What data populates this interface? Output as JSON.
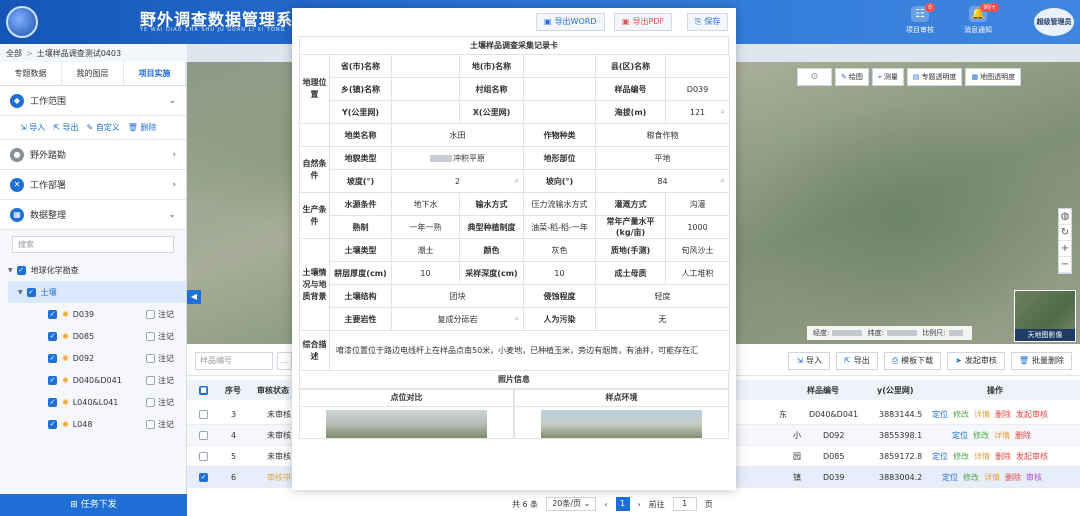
{
  "header": {
    "title": "野外调查数据管理系统",
    "pinyin": "YE WAI DIAO CHA SHU JU GUAN LI XI TONG",
    "review_label": "项目审核",
    "review_badge": "0",
    "notice_label": "消息通知",
    "notice_badge": "99+",
    "user": "超级管理员"
  },
  "breadcrumb": {
    "root": "全部",
    "current": "土壤样品调查测试0403"
  },
  "sidebar": {
    "tabs": [
      "专题数据",
      "我的图层",
      "项目实施"
    ],
    "panels": {
      "scope": "工作范围",
      "survey": "野外踏勘",
      "deploy": "工作部署",
      "data": "数据整理"
    },
    "scope_tools": {
      "import": "导入",
      "export": "导出",
      "custom": "自定义",
      "delete": "删除"
    },
    "search_placeholder": "搜索",
    "tree": {
      "root": "地球化学勘查",
      "child": "土壤",
      "leaves": [
        "D039",
        "D085",
        "D092",
        "D040&D041",
        "L040&L041",
        "L048"
      ],
      "mark_label": "注记"
    },
    "task_button": "任务下发"
  },
  "map": {
    "tools": {
      "draw": "绘图",
      "measure": "测量",
      "thematic": "专题透明度",
      "base": "地图透明度"
    },
    "coord": {
      "lon": "经度:",
      "lat": "纬度:",
      "scale": "比例尺:"
    },
    "basemap": "天地图影像"
  },
  "table": {
    "filter_placeholder": "样品编号",
    "buttons": {
      "import": "导入",
      "export": "导出",
      "template": "模板下载",
      "submit": "发起审核",
      "batch_delete": "批量删除"
    },
    "headers": {
      "index": "序号",
      "status": "审核状态",
      "sample": "样品编号",
      "y": "y(公里网)",
      "ops": "操作"
    },
    "rows": [
      {
        "index": "3",
        "status": "未审核",
        "suffix": "东",
        "sample": "D040&D041",
        "y": "3883144.5"
      },
      {
        "index": "4",
        "status": "未审核",
        "suffix": "小",
        "sample": "D092",
        "y": "3855398.1"
      },
      {
        "index": "5",
        "status": "未审核",
        "suffix": "园",
        "sample": "D085",
        "y": "3859172.8"
      },
      {
        "index": "6",
        "status": "审核中",
        "suffix": "镇",
        "sample": "D039",
        "y": "3883004.2"
      }
    ],
    "actions": {
      "locate": "定位",
      "edit": "修改",
      "detail": "详情",
      "delete": "删除",
      "submit": "发起审核",
      "review": "审核"
    },
    "pager": {
      "total": "共 6 条",
      "size": "20条/页",
      "current": "1",
      "goto": "前往",
      "page_input": "1",
      "page_unit": "页"
    }
  },
  "modal": {
    "buttons": {
      "word": "导出WORD",
      "pdf": "导出PDF",
      "save": "保存"
    },
    "card_title": "土壤样品调查采集记录卡",
    "groups": {
      "geo": "地理位置",
      "nature": "自然条件",
      "production": "生产条件",
      "soil": "土壤情况与地质背景",
      "desc": "综合描述",
      "photos": "照片信息"
    },
    "labels": {
      "province": "省(市)名称",
      "city": "地(市)名称",
      "county": "县(区)名称",
      "town": "乡(镇)名称",
      "village": "村组名称",
      "sample_no": "样品编号",
      "y": "Y(公里网)",
      "x": "X(公里网)",
      "elevation": "海拔(m)",
      "landform_name": "地类名称",
      "crop": "作物种类",
      "terrain": "地貌类型",
      "position": "地形部位",
      "slope": "坡度(°)",
      "aspect": "坡向(°)",
      "water": "水源条件",
      "irrigation": "输水方式",
      "irrigate_method": "灌溉方式",
      "maturity": "熟制",
      "planting": "典型种植制度",
      "yield": "常年产量水平(kg/亩)",
      "soil_type": "土壤类型",
      "color": "颜色",
      "texture": "质地(手测)",
      "plough_depth": "耕层厚度(cm)",
      "sample_depth": "采样深度(cm)",
      "parent": "成土母质",
      "structure": "土壤结构",
      "erosion": "侵蚀程度",
      "rock": "主要岩性",
      "pollution": "人为污染"
    },
    "values": {
      "sample_no": "D039",
      "elevation": "121",
      "landform_name": "水田",
      "crop": "粮食作物",
      "terrain": "冲积平原",
      "position": "平地",
      "slope": "2",
      "aspect": "84",
      "water": "地下水",
      "irrigation": "压力流输水方式",
      "irrigate_method": "沟灌",
      "maturity": "一年一熟",
      "planting": "油菜-稻-稻-一年",
      "yield": "1000",
      "soil_type": "潮土",
      "color": "灰色",
      "texture": "旬风沙土",
      "plough_depth": "10",
      "sample_depth": "10",
      "parent": "人工堆积",
      "structure": "团块",
      "erosion": "轻度",
      "rock": "复成分砾岩",
      "pollution": "无",
      "desc": "唷漆位置位于路边电线杆上在样品点南50米，小麦地，已种植玉米，旁边有烟筒，有油井，可能存在汇"
    },
    "photos": {
      "compare": "点位对比",
      "env": "样点环境"
    }
  }
}
